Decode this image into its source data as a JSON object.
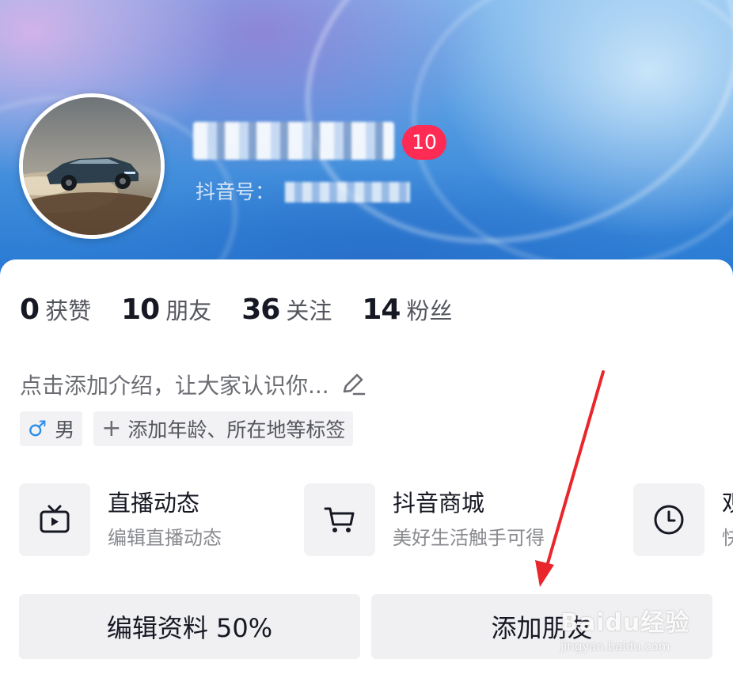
{
  "profile": {
    "level_badge": "10",
    "douyin_id_label": "抖音号："
  },
  "stats": [
    {
      "num": "0",
      "label": "获赞"
    },
    {
      "num": "10",
      "label": "朋友"
    },
    {
      "num": "36",
      "label": "关注"
    },
    {
      "num": "14",
      "label": "粉丝"
    }
  ],
  "bio": {
    "placeholder": "点击添加介绍，让大家认识你..."
  },
  "tags": {
    "gender_symbol": "♂",
    "gender": "男",
    "add_symbol": "+",
    "add_tags": "添加年龄、所在地等标签"
  },
  "entries": [
    {
      "icon": "tv-icon",
      "title": "直播动态",
      "sub": "编辑直播动态"
    },
    {
      "icon": "cart-icon",
      "title": "抖音商城",
      "sub": "美好生活触手可得"
    },
    {
      "icon": "clock-icon",
      "title": "观",
      "sub": "快"
    }
  ],
  "buttons": {
    "edit_profile": "编辑资料 50%",
    "add_friend": "添加朋友"
  },
  "watermark": {
    "main": "Baidu经验",
    "sub": "jingyan.baidu.com"
  },
  "colors": {
    "badge": "#fe2c55",
    "annotation_arrow": "#e8262b",
    "gender_icon": "#2b8ee9"
  }
}
